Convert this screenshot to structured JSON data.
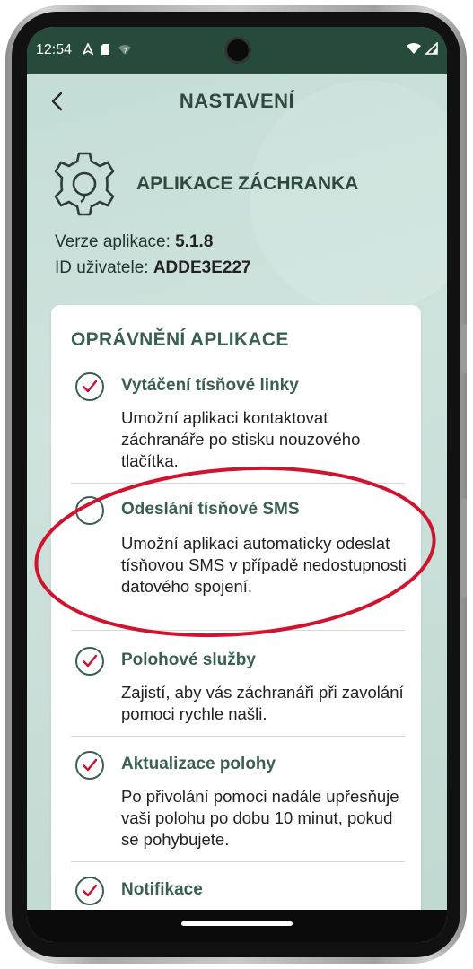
{
  "status_bar": {
    "time": "12:54",
    "icons_left": [
      "navigation-icon",
      "sd-card-icon",
      "wifi-question-icon"
    ],
    "icons_right": [
      "wifi-icon",
      "signal-icon"
    ]
  },
  "header": {
    "title": "NASTAVENÍ",
    "back_icon": "chevron-left-icon"
  },
  "app": {
    "name": "APLIKACE ZÁCHRANKA",
    "version_label": "Verze aplikace:",
    "version_value": "5.1.8",
    "user_id_label": "ID uživatele:",
    "user_id_value": "ADDE3E227"
  },
  "permissions": {
    "title": "OPRÁVNĚNÍ APLIKACE",
    "items": [
      {
        "title": "Vytáčení tísňové linky",
        "desc": "Umožní aplikaci kontaktovat záchranáře po stisku nouzového tlačítka.",
        "checked": true
      },
      {
        "title": "Odeslání tísňové SMS",
        "desc": "Umožní aplikaci automaticky odeslat tísňovou SMS v případě nedostupnosti datového spojení.",
        "checked": false
      },
      {
        "title": "Polohové služby",
        "desc": "Zajistí, aby vás záchranáři při zavolání pomoci rychle našli.",
        "checked": true
      },
      {
        "title": "Aktualizace polohy",
        "desc": "Po přivolání pomoci nadále upřesňuje vaši polohu po dobu 10 minut, pokud se pohybujete.",
        "checked": true
      },
      {
        "title": "Notifikace",
        "desc": "",
        "checked": true
      }
    ]
  },
  "colors": {
    "status_bar": "#264b3b",
    "accent_green": "#3a6053",
    "check_red": "#c8102e",
    "highlight_red": "#d0142f"
  }
}
